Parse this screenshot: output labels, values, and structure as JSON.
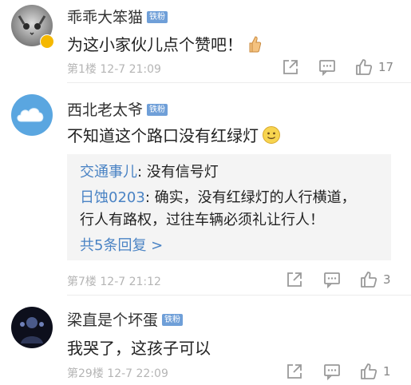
{
  "badge_label": "铁粉",
  "comments": [
    {
      "username": "乖乖大笨猫",
      "text": "为这小家伙儿点个赞吧！",
      "floor": "第1楼",
      "date": "12-7 21:09",
      "likes": "17",
      "emoji": "thumbs-up-icon"
    },
    {
      "username": "西北老太爷",
      "text": "不知道这个路口没有红绿灯",
      "floor": "第7楼",
      "date": "12-7 21:12",
      "likes": "3",
      "emoji": "smile-icon",
      "replies": [
        {
          "user": "交通事儿",
          "text": "没有信号灯"
        },
        {
          "user": "日蚀0203",
          "text": "确实，没有红绿灯的人行横道，",
          "cont": "行人有路权，过往车辆必须礼让行人！"
        }
      ],
      "more_replies": "共5条回复 >"
    },
    {
      "username": "梁直是个坏蛋",
      "text": "我哭了，这孩子可以",
      "floor": "第29楼",
      "date": "12-7 22:09",
      "likes": "1"
    }
  ],
  "colors": {
    "badge": "#6f9fd8",
    "link": "#4a83c4",
    "meta": "#b5b5b5"
  }
}
